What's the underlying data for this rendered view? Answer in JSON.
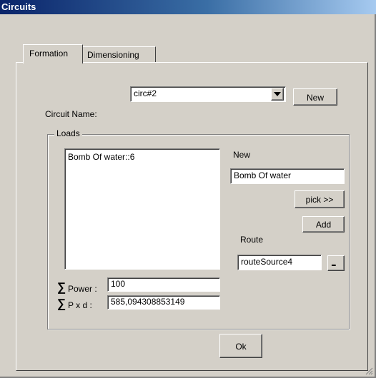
{
  "window": {
    "title": "Circuits"
  },
  "tabs": [
    {
      "label": "Formation",
      "active": true
    },
    {
      "label": "Dimensioning",
      "active": false
    }
  ],
  "circuit": {
    "name_label": "Circuit Name:",
    "name_value": "circ#2",
    "new_button": "New"
  },
  "loads": {
    "group_label": "Loads",
    "items": [
      "Bomb Of water::6"
    ],
    "new_label": "New",
    "new_value": "Bomb Of water",
    "pick_button": "pick >>",
    "add_button": "Add",
    "route_label": "Route",
    "route_value": "routeSource4",
    "route_browse": "..."
  },
  "totals": {
    "sigma": "∑",
    "power_label": "Power :",
    "power_value": "100",
    "pxd_label": "P x d :",
    "pxd_value": "585,094308853149"
  },
  "ok_button": "Ok"
}
